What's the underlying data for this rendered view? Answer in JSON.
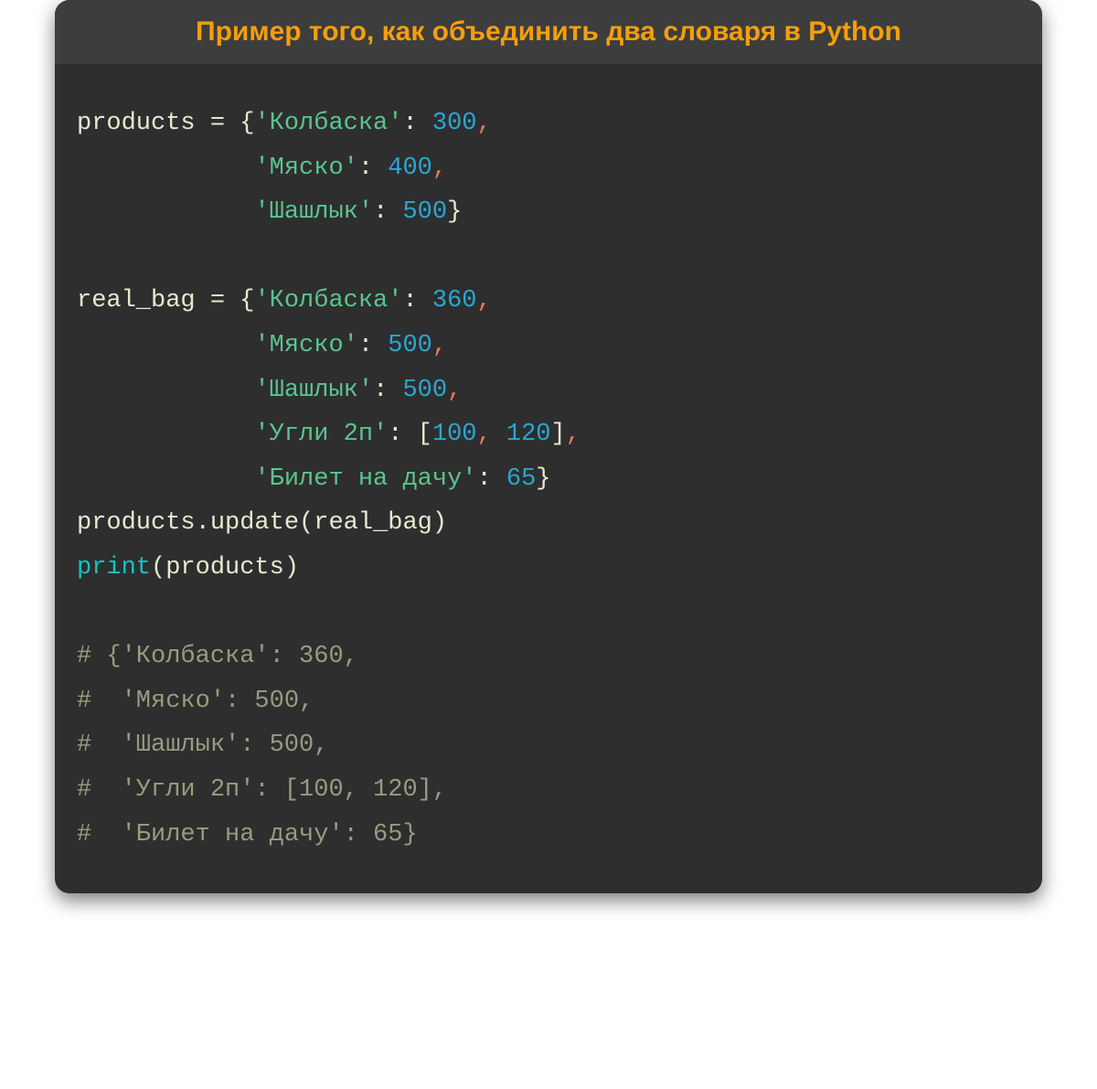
{
  "title": "Пример того, как объединить два словаря в Python",
  "code": {
    "l1": {
      "var": "products",
      "eq": " = ",
      "lb": "{",
      "s1": "'Колбаска'",
      "c1": ": ",
      "n1": "300",
      "cm": ","
    },
    "l2": {
      "pad": "            ",
      "s1": "'Мяско'",
      "c1": ": ",
      "n1": "400",
      "cm": ","
    },
    "l3": {
      "pad": "            ",
      "s1": "'Шашлык'",
      "c1": ": ",
      "n1": "500",
      "rb": "}"
    },
    "l4": {
      "blank": ""
    },
    "l5": {
      "var": "real_bag",
      "eq": " = ",
      "lb": "{",
      "s1": "'Колбаска'",
      "c1": ": ",
      "n1": "360",
      "cm": ","
    },
    "l6": {
      "pad": "            ",
      "s1": "'Мяско'",
      "c1": ": ",
      "n1": "500",
      "cm": ","
    },
    "l7": {
      "pad": "            ",
      "s1": "'Шашлык'",
      "c1": ": ",
      "n1": "500",
      "cm": ","
    },
    "l8": {
      "pad": "            ",
      "s1": "'Угли 2п'",
      "c1": ": ",
      "lb": "[",
      "n1": "100",
      "cm1": ",",
      "sp": " ",
      "n2": "120",
      "rb": "]",
      "cm": ","
    },
    "l9": {
      "pad": "            ",
      "s1": "'Билет на дачу'",
      "c1": ": ",
      "n1": "65",
      "rb": "}"
    },
    "l10": {
      "text": "products.update(real_bag)"
    },
    "l11": {
      "fn": "print",
      "args": "(products)"
    },
    "l12": {
      "blank": ""
    },
    "l13": {
      "comment": "# {'Колбаска': 360,"
    },
    "l14": {
      "comment": "#  'Мяско': 500,"
    },
    "l15": {
      "comment": "#  'Шашлык': 500,"
    },
    "l16": {
      "comment": "#  'Угли 2п': [100, 120],"
    },
    "l17": {
      "comment": "#  'Билет на дачу': 65}"
    }
  }
}
